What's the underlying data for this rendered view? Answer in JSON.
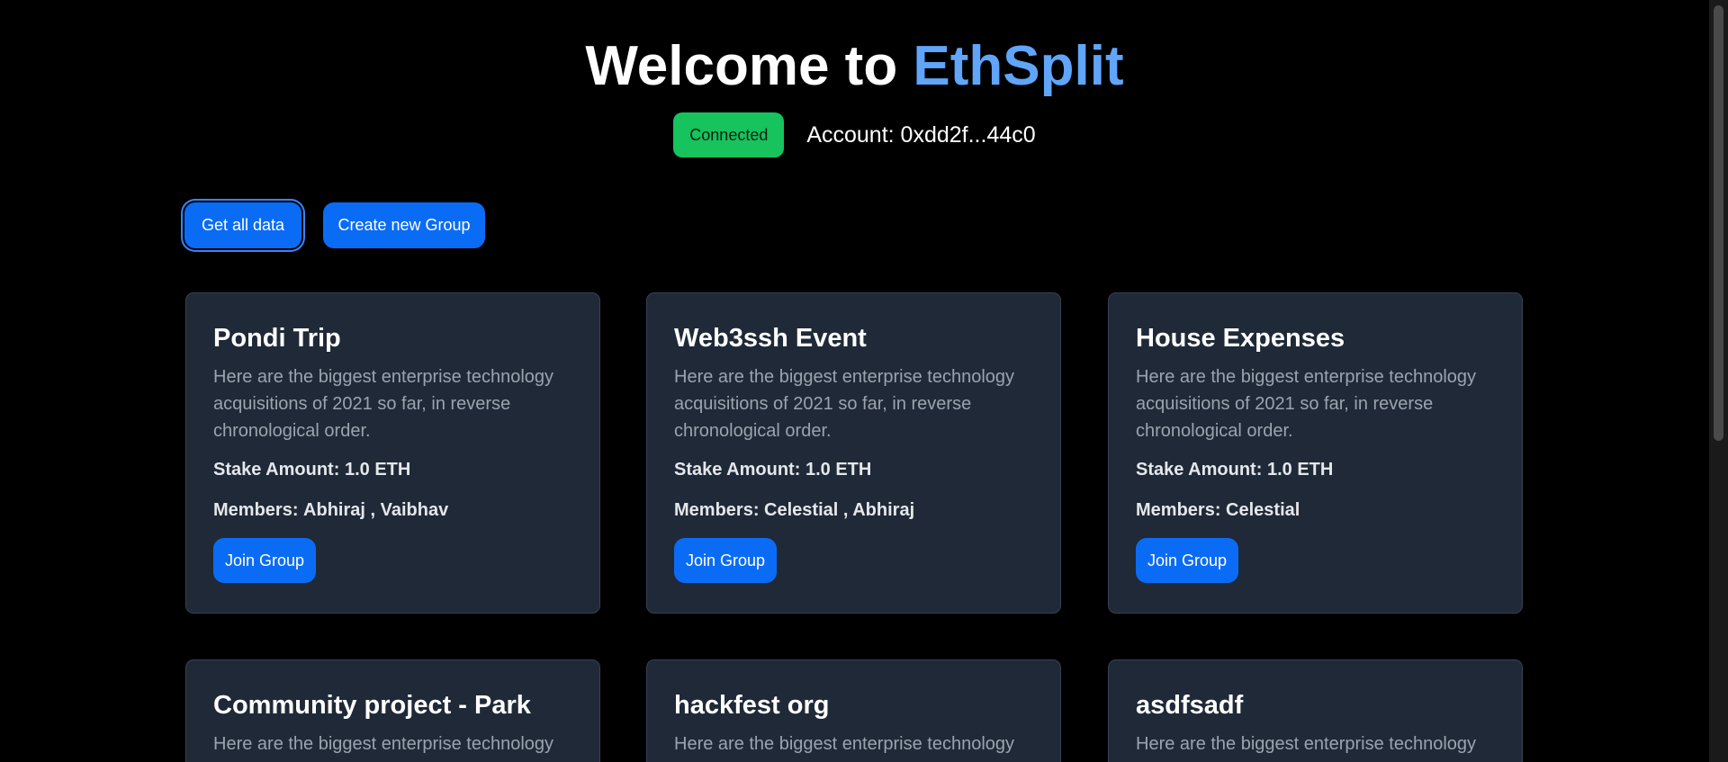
{
  "header": {
    "title_prefix": "Welcome to ",
    "title_brand": "EthSplit",
    "status_badge": "Connected",
    "account": "Account: 0xdd2f...44c0"
  },
  "actions": {
    "get_all_data": "Get all data",
    "create_group": "Create new Group"
  },
  "cards": [
    {
      "title": "Pondi Trip",
      "description": "Here are the biggest enterprise technology acquisitions of 2021 so far, in reverse chronological order.",
      "stake_label": "Stake Amount:",
      "stake_value": "1.0 ETH",
      "members_label": "Members:",
      "members_value": "Abhiraj , Vaibhav",
      "join_label": "Join Group"
    },
    {
      "title": "Web3ssh Event",
      "description": "Here are the biggest enterprise technology acquisitions of 2021 so far, in reverse chronological order.",
      "stake_label": "Stake Amount:",
      "stake_value": "1.0 ETH",
      "members_label": "Members:",
      "members_value": "Celestial , Abhiraj",
      "join_label": "Join Group"
    },
    {
      "title": "House Expenses",
      "description": "Here are the biggest enterprise technology acquisitions of 2021 so far, in reverse chronological order.",
      "stake_label": "Stake Amount:",
      "stake_value": "1.0 ETH",
      "members_label": "Members:",
      "members_value": "Celestial",
      "join_label": "Join Group"
    },
    {
      "title": "Community project - Park",
      "description": "Here are the biggest enterprise technology",
      "stake_label": "",
      "stake_value": "",
      "members_label": "",
      "members_value": "",
      "join_label": ""
    },
    {
      "title": "hackfest org",
      "description": "Here are the biggest enterprise technology",
      "stake_label": "",
      "stake_value": "",
      "members_label": "",
      "members_value": "",
      "join_label": ""
    },
    {
      "title": "asdfsadf",
      "description": "Here are the biggest enterprise technology",
      "stake_label": "",
      "stake_value": "",
      "members_label": "",
      "members_value": "",
      "join_label": ""
    }
  ],
  "colors": {
    "background": "#000000",
    "brand": "#60a5fa",
    "badge": "#16c35c",
    "primary_button": "#0a6cf5",
    "card_bg": "#1f2937"
  }
}
